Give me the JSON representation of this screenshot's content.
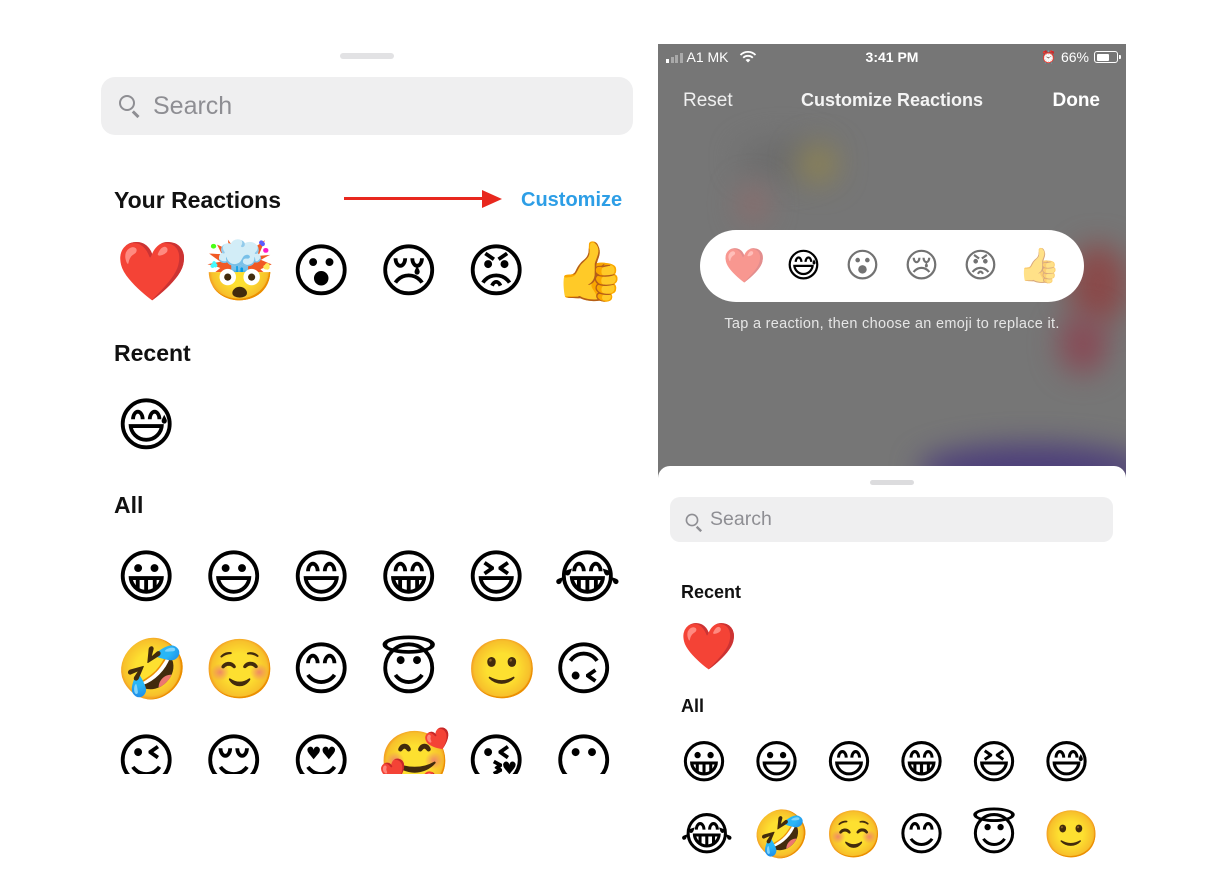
{
  "left_panel": {
    "search": {
      "placeholder": "Search",
      "icon": "search-icon"
    },
    "sections": {
      "reactions_title": "Your Reactions",
      "customize_label": "Customize",
      "annotation": "red-arrow-pointing-to-customize",
      "recent_title": "Recent",
      "all_title": "All"
    },
    "your_reactions": [
      "❤️",
      "🤯",
      "😮",
      "😢",
      "😡",
      "👍"
    ],
    "recent": [
      "😅"
    ],
    "all_rows": [
      [
        "😀",
        "😃",
        "😄",
        "😁",
        "😆",
        "😂"
      ],
      [
        "🤣",
        "☺️",
        "😊",
        "😇",
        "🙂",
        "🙃"
      ],
      [
        "😉",
        "😌",
        "😍",
        "🥰",
        "😘",
        "😶"
      ]
    ]
  },
  "right_panel": {
    "status_bar": {
      "carrier": "A1 MK",
      "time": "3:41 PM",
      "battery_percent_label": "66%",
      "battery_level": 0.66,
      "signal_bars_active": 1,
      "signal_bars_total": 4,
      "alarm_icon": "⏰"
    },
    "nav": {
      "reset_label": "Reset",
      "title": "Customize Reactions",
      "done_label": "Done"
    },
    "reaction_bar": {
      "items": [
        "❤️",
        "😅",
        "😮",
        "😢",
        "😡",
        "👍"
      ],
      "selected_index": 1
    },
    "hint": "Tap a reaction, then choose an emoji to replace it.",
    "sheet": {
      "search": {
        "placeholder": "Search",
        "icon": "search-icon"
      },
      "recent_title": "Recent",
      "all_title": "All",
      "recent": [
        "❤️"
      ],
      "all_rows": [
        [
          "😀",
          "😃",
          "😄",
          "😁",
          "😆",
          "😅"
        ],
        [
          "😂",
          "🤣",
          "☺️",
          "😊",
          "😇",
          "🙂"
        ]
      ]
    }
  }
}
